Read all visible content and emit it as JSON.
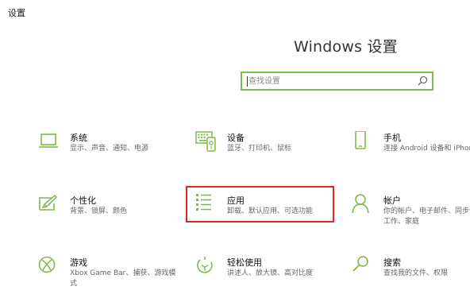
{
  "window": {
    "title": "设置"
  },
  "header": {
    "title": "Windows 设置"
  },
  "search": {
    "placeholder": "查找设置",
    "icon": "search-icon"
  },
  "colors": {
    "accent": "#7dba49",
    "highlight_box": "#e02525",
    "text_primary": "#111111",
    "text_secondary": "#666666"
  },
  "tiles": [
    {
      "name": "系统",
      "desc": "显示、声音、通知、电源",
      "icon": "laptop-icon"
    },
    {
      "name": "设备",
      "desc": "蓝牙、打印机、鼠标",
      "icon": "keyboard-icon"
    },
    {
      "name": "手机",
      "desc": "连接 Android 设备和 iPhone",
      "icon": "phone-icon"
    },
    {
      "name": "个性化",
      "desc": "背景、锁屏、颜色",
      "icon": "paint-icon"
    },
    {
      "name": "应用",
      "desc": "卸载、默认应用、可选功能",
      "icon": "apps-list-icon"
    },
    {
      "name": "帐户",
      "desc": "你的帐户、电子邮件、同步设置、工作、家庭",
      "icon": "person-icon"
    },
    {
      "name": "游戏",
      "desc": "Xbox Game Bar、捕获、游戏模式",
      "icon": "xbox-icon"
    },
    {
      "name": "轻松使用",
      "desc": "讲述人、放大镜、高对比度",
      "icon": "ease-of-access-icon"
    },
    {
      "name": "搜索",
      "desc": "查找我的文件、权限",
      "icon": "magnifier-icon"
    }
  ]
}
